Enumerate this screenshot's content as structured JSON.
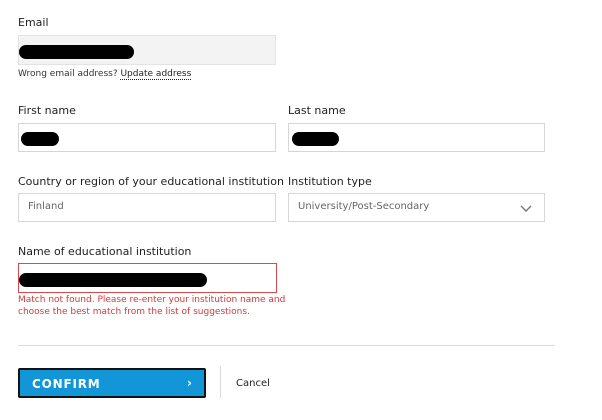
{
  "form": {
    "email": {
      "label": "Email",
      "helper_text": "Wrong email address? ",
      "helper_link": "Update address"
    },
    "first_name": {
      "label": "First name"
    },
    "last_name": {
      "label": "Last name"
    },
    "country": {
      "label": "Country or region of your educational institution",
      "value": "Finland"
    },
    "institution_type": {
      "label": "Institution type",
      "value": "University/Post-Secondary"
    },
    "institution_name": {
      "label": "Name of educational institution",
      "error_line1": "Match not found. Please re-enter your institution name and",
      "error_line2": "choose the best match from the list of suggestions."
    }
  },
  "actions": {
    "confirm_label": "CONFIRM",
    "confirm_chevron": "›",
    "cancel_label": "Cancel"
  },
  "colors": {
    "primary": "#1296d8",
    "error": "#d33a3a",
    "readonly_bg": "#f3f3f3"
  }
}
